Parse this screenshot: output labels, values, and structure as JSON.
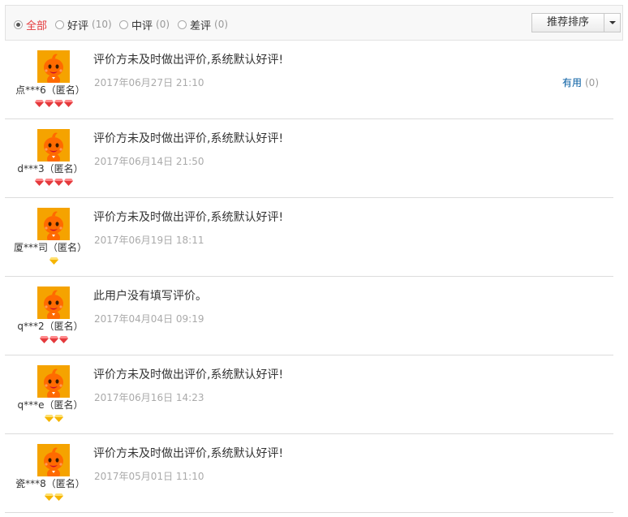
{
  "filters": [
    {
      "label": "全部",
      "count": "",
      "selected": true
    },
    {
      "label": "好评",
      "count": "(10)",
      "selected": false
    },
    {
      "label": "中评",
      "count": "(0)",
      "selected": false
    },
    {
      "label": "差评",
      "count": "(0)",
      "selected": false
    }
  ],
  "sort": {
    "label": "推荐排序"
  },
  "useful": {
    "label": "有用",
    "count": "(0)"
  },
  "colors": {
    "active_filter": "#e4393c",
    "link": "#005aa0",
    "red_gem": "#e4393c",
    "gold_gem": "#f5b400",
    "avatar_bg": "#f5a300"
  },
  "reviews": [
    {
      "user": "点***6（匿名）",
      "level_icons": 4,
      "level_type": "red-gem-icon",
      "content": "评价方未及时做出评价,系统默认好评!",
      "time": "2017年06月27日 21:10"
    },
    {
      "user": "d***3（匿名）",
      "level_icons": 4,
      "level_type": "red-gem-icon",
      "content": "评价方未及时做出评价,系统默认好评!",
      "time": "2017年06月14日 21:50"
    },
    {
      "user": "厦***司（匿名）",
      "level_icons": 1,
      "level_type": "gold-gem-icon",
      "content": "评价方未及时做出评价,系统默认好评!",
      "time": "2017年06月19日 18:11"
    },
    {
      "user": "q***2（匿名）",
      "level_icons": 3,
      "level_type": "red-gem-icon",
      "content": "此用户没有填写评价。",
      "time": "2017年04月04日 09:19"
    },
    {
      "user": "q***e（匿名）",
      "level_icons": 2,
      "level_type": "gold-gem-icon",
      "content": "评价方未及时做出评价,系统默认好评!",
      "time": "2017年06月16日 14:23"
    },
    {
      "user": "瓷***8（匿名）",
      "level_icons": 2,
      "level_type": "gold-gem-icon",
      "content": "评价方未及时做出评价,系统默认好评!",
      "time": "2017年05月01日 11:10"
    }
  ]
}
